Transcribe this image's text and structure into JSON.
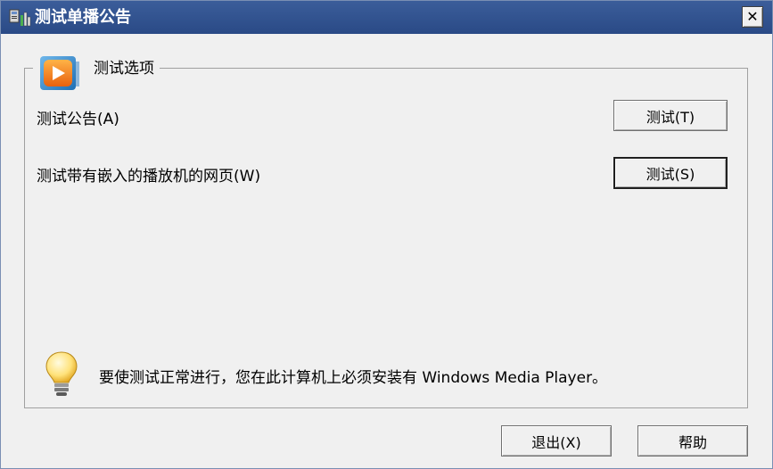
{
  "window": {
    "title": "测试单播公告",
    "close_label": "✕"
  },
  "group": {
    "title": "测试选项",
    "icon": "windows-media-player-icon"
  },
  "rows": [
    {
      "label": "测试公告(A)",
      "button_label": "测试(T)"
    },
    {
      "label": "测试带有嵌入的播放机的网页(W)",
      "button_label": "测试(S)"
    }
  ],
  "info": {
    "icon": "lightbulb-icon",
    "text": "要使测试正常进行，您在此计算机上必须安装有 Windows Media Player。"
  },
  "footer": {
    "exit_label": "退出(X)",
    "help_label": "帮助"
  },
  "colors": {
    "titlebar": "#2f5190",
    "window_bg": "#f0f0f0",
    "wmp_orange": "#f07a1a",
    "wmp_blue": "#3a8fd0"
  }
}
